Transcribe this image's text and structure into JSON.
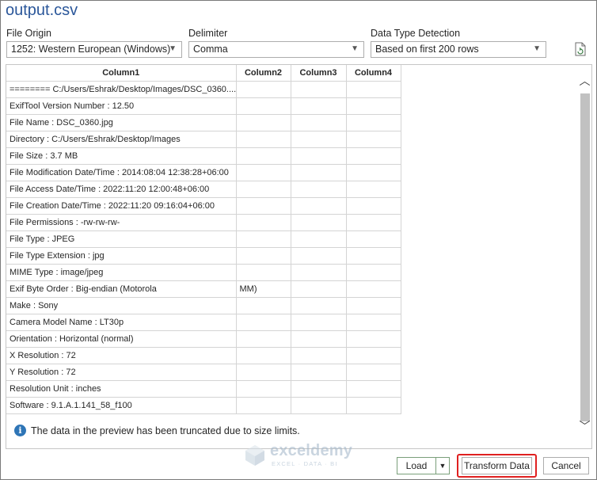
{
  "window": {
    "title": "output.csv"
  },
  "file_origin": {
    "label": "File Origin",
    "value": "1252: Western European (Windows)"
  },
  "delimiter": {
    "label": "Delimiter",
    "value": "Comma"
  },
  "data_type_detection": {
    "label": "Data Type Detection",
    "value": "Based on first 200 rows"
  },
  "icons": {
    "refresh": "file-refresh-icon",
    "info": "info-icon",
    "watermark": "exceldemy-logo"
  },
  "table": {
    "columns": [
      "Column1",
      "Column2",
      "Column3",
      "Column4"
    ],
    "rows": [
      [
        "======== C:/Users/Eshrak/Desktop/Images/DSC_0360....",
        "",
        "",
        ""
      ],
      [
        "ExifTool Version Number : 12.50",
        "",
        "",
        ""
      ],
      [
        "File Name : DSC_0360.jpg",
        "",
        "",
        ""
      ],
      [
        "Directory : C:/Users/Eshrak/Desktop/Images",
        "",
        "",
        ""
      ],
      [
        "File Size : 3.7 MB",
        "",
        "",
        ""
      ],
      [
        "File Modification Date/Time : 2014:08:04 12:38:28+06:00",
        "",
        "",
        ""
      ],
      [
        "File Access Date/Time : 2022:11:20 12:00:48+06:00",
        "",
        "",
        ""
      ],
      [
        "File Creation Date/Time : 2022:11:20 09:16:04+06:00",
        "",
        "",
        ""
      ],
      [
        "File Permissions : -rw-rw-rw-",
        "",
        "",
        ""
      ],
      [
        "File Type : JPEG",
        "",
        "",
        ""
      ],
      [
        "File Type Extension : jpg",
        "",
        "",
        ""
      ],
      [
        "MIME Type : image/jpeg",
        "",
        "",
        ""
      ],
      [
        "Exif Byte Order : Big-endian (Motorola",
        "MM)",
        "",
        ""
      ],
      [
        "Make : Sony",
        "",
        "",
        ""
      ],
      [
        "Camera Model Name : LT30p",
        "",
        "",
        ""
      ],
      [
        "Orientation : Horizontal (normal)",
        "",
        "",
        ""
      ],
      [
        "X Resolution : 72",
        "",
        "",
        ""
      ],
      [
        "Y Resolution : 72",
        "",
        "",
        ""
      ],
      [
        "Resolution Unit : inches",
        "",
        "",
        ""
      ],
      [
        "Software : 9.1.A.1.141_58_f100",
        "",
        "",
        ""
      ]
    ]
  },
  "notice": "The data in the preview has been truncated due to size limits.",
  "watermark": {
    "name": "exceldemy",
    "tagline": "EXCEL · DATA · BI"
  },
  "buttons": {
    "load": "Load",
    "transform": "Transform Data",
    "cancel": "Cancel"
  },
  "colors": {
    "title": "#2b579a",
    "highlight": "#e02020",
    "info": "#2e75b6"
  }
}
